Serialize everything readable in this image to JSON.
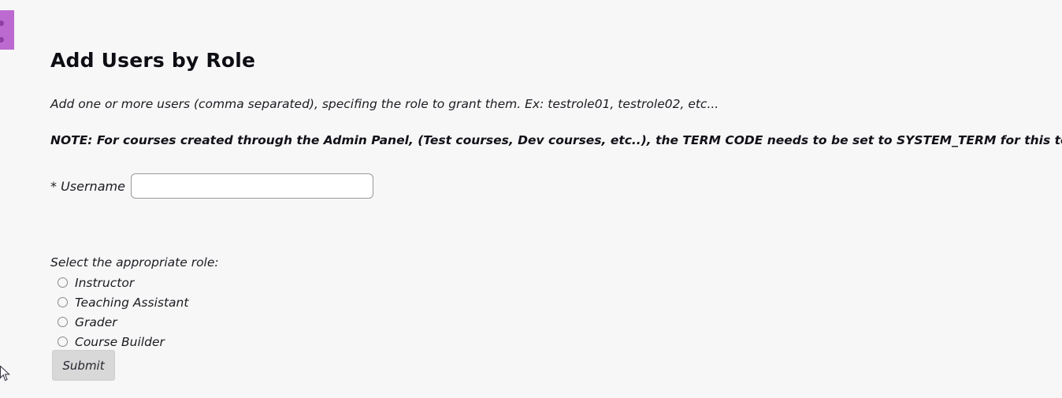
{
  "page": {
    "title": "Add Users by Role",
    "intro": "Add one or more users (comma separated), specifing the role to grant them. Ex: testrole01, testrole02, etc...",
    "note": "NOTE: For courses created through the Admin Panel, (Test courses, Dev courses, etc..), the TERM CODE needs to be set to SYSTEM_TERM for this tool to function.",
    "background_color": "#f7f7f7"
  },
  "corner_panel": {
    "color": "#bd6ad0",
    "dot_color": "#8e3fa3"
  },
  "form": {
    "username": {
      "label": "* Username",
      "value": "",
      "placeholder": ""
    },
    "role_prompt": "Select the appropriate role:",
    "roles": [
      {
        "label": "Instructor",
        "selected": false
      },
      {
        "label": "Teaching Assistant",
        "selected": false
      },
      {
        "label": "Grader",
        "selected": false
      },
      {
        "label": "Course Builder",
        "selected": false
      }
    ],
    "submit_label": "Submit"
  },
  "cursor": {
    "icon": "mouse-pointer-icon"
  }
}
